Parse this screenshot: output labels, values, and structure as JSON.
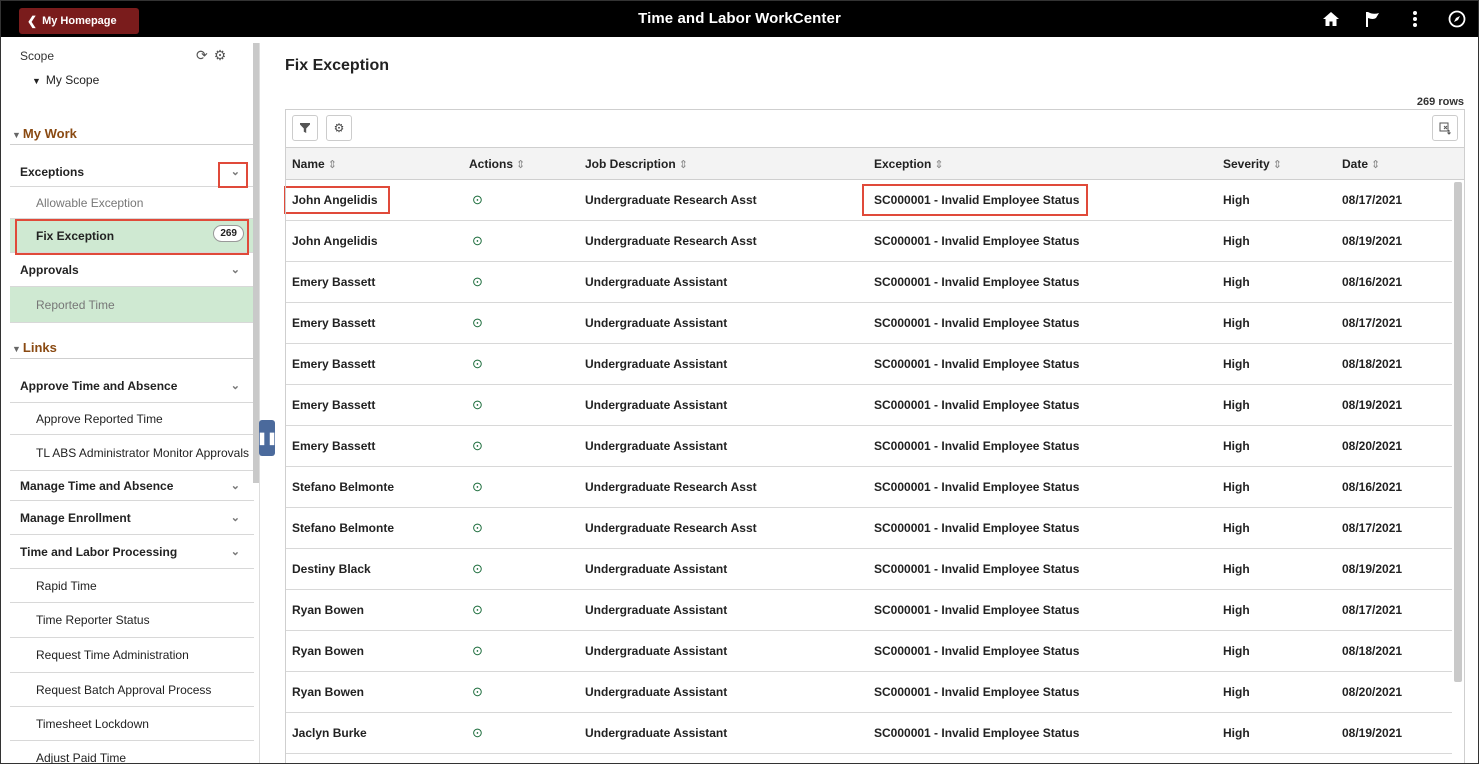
{
  "header": {
    "home_label": "My Homepage",
    "title": "Time and Labor WorkCenter",
    "icons": [
      "home-icon",
      "flag-icon",
      "more-options-icon",
      "compass-icon"
    ]
  },
  "sidebar": {
    "scope_label": "Scope",
    "my_scope": "My Scope",
    "my_work_heading": "My Work",
    "exceptions_label": "Exceptions",
    "allowable_exception": "Allowable Exception",
    "fix_exception": "Fix Exception",
    "fix_exception_count": "269",
    "approvals_label": "Approvals",
    "reported_time": "Reported Time",
    "links_heading": "Links",
    "approve_group": "Approve Time and Absence",
    "approve_reported_time": "Approve Reported Time",
    "tl_abs_monitor": "TL ABS Administrator Monitor Approvals",
    "manage_time": "Manage Time and Absence",
    "manage_enrollment": "Manage Enrollment",
    "tl_processing": "Time and Labor Processing",
    "rapid_time": "Rapid Time",
    "time_reporter_status": "Time Reporter Status",
    "request_time_admin": "Request Time Administration",
    "request_batch": "Request Batch Approval Process",
    "timesheet_lockdown": "Timesheet Lockdown",
    "adjust_paid_time": "Adjust Paid Time"
  },
  "main": {
    "title": "Fix Exception",
    "row_count": "269 rows",
    "columns": [
      "Name",
      "Actions",
      "Job Description",
      "Exception",
      "Severity",
      "Date"
    ],
    "rows": [
      {
        "name": "John Angelidis",
        "job": "Undergraduate Research Asst",
        "exception": "SC000001 - Invalid Employee Status",
        "severity": "High",
        "date": "08/17/2021"
      },
      {
        "name": "John Angelidis",
        "job": "Undergraduate Research Asst",
        "exception": "SC000001 - Invalid Employee Status",
        "severity": "High",
        "date": "08/19/2021"
      },
      {
        "name": "Emery Bassett",
        "job": "Undergraduate Assistant",
        "exception": "SC000001 - Invalid Employee Status",
        "severity": "High",
        "date": "08/16/2021"
      },
      {
        "name": "Emery Bassett",
        "job": "Undergraduate Assistant",
        "exception": "SC000001 - Invalid Employee Status",
        "severity": "High",
        "date": "08/17/2021"
      },
      {
        "name": "Emery Bassett",
        "job": "Undergraduate Assistant",
        "exception": "SC000001 - Invalid Employee Status",
        "severity": "High",
        "date": "08/18/2021"
      },
      {
        "name": "Emery Bassett",
        "job": "Undergraduate Assistant",
        "exception": "SC000001 - Invalid Employee Status",
        "severity": "High",
        "date": "08/19/2021"
      },
      {
        "name": "Emery Bassett",
        "job": "Undergraduate Assistant",
        "exception": "SC000001 - Invalid Employee Status",
        "severity": "High",
        "date": "08/20/2021"
      },
      {
        "name": "Stefano Belmonte",
        "job": "Undergraduate Research Asst",
        "exception": "SC000001 - Invalid Employee Status",
        "severity": "High",
        "date": "08/16/2021"
      },
      {
        "name": "Stefano Belmonte",
        "job": "Undergraduate Research Asst",
        "exception": "SC000001 - Invalid Employee Status",
        "severity": "High",
        "date": "08/17/2021"
      },
      {
        "name": "Destiny Black",
        "job": "Undergraduate Assistant",
        "exception": "SC000001 - Invalid Employee Status",
        "severity": "High",
        "date": "08/19/2021"
      },
      {
        "name": "Ryan Bowen",
        "job": "Undergraduate Assistant",
        "exception": "SC000001 - Invalid Employee Status",
        "severity": "High",
        "date": "08/17/2021"
      },
      {
        "name": "Ryan Bowen",
        "job": "Undergraduate Assistant",
        "exception": "SC000001 - Invalid Employee Status",
        "severity": "High",
        "date": "08/18/2021"
      },
      {
        "name": "Ryan Bowen",
        "job": "Undergraduate Assistant",
        "exception": "SC000001 - Invalid Employee Status",
        "severity": "High",
        "date": "08/20/2021"
      },
      {
        "name": "Jaclyn Burke",
        "job": "Undergraduate Assistant",
        "exception": "SC000001 - Invalid Employee Status",
        "severity": "High",
        "date": "08/19/2021"
      }
    ]
  },
  "colors": {
    "header_bg": "#000000",
    "home_button": "#7a1c1c",
    "active_item": "#cfe9d2",
    "highlight": "#e04a3a",
    "section_heading": "#8a4a12"
  }
}
